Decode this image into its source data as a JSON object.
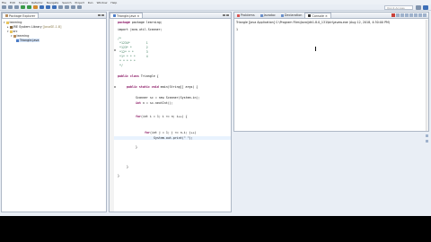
{
  "menubar": {
    "items": [
      "File",
      "Edit",
      "Source",
      "Refactor",
      "Navigate",
      "Search",
      "Project",
      "Run",
      "Window",
      "Help"
    ]
  },
  "toolbar": {
    "quick_access_label": "Quick Access"
  },
  "explorer": {
    "tab_label": "Package Explorer",
    "tree": {
      "project": "learning",
      "jre": "JRE System Library",
      "jre_decor": "[JavaSE-1.8]",
      "src": "src",
      "package": "learning",
      "file": "Triangle.java"
    }
  },
  "editor": {
    "tab_label": "Triangle.java",
    "lines": {
      "l1": "package learning;",
      "l3": "import java.util.Scanner;",
      "l5": "/*",
      "l6": " *1234*         1",
      "l7": " *123* *        2",
      "l8": " *12* * *       3",
      "l9": " *1* * * *      4",
      "l10": " * * * * *",
      "l11": " */",
      "l13a": "public class ",
      "l13b": "Triangle {",
      "l15a": "public static void ",
      "l15b": "main(String[] args) {",
      "l17": "Scanner sc = new Scanner(System.in);",
      "l18a": "int ",
      "l18b": "n = sc.nextInt();",
      "l20a": "for",
      "l20b": "(int i = 1; i <= n; i++) {",
      "l22a": "for",
      "l22b": "(int j = 1; j <= n-i; j++)",
      "l23": "System.out.print(\" \");",
      "l25": "}",
      "l28": "}",
      "l30": "}"
    }
  },
  "console": {
    "tabs": [
      "Problems",
      "Javadoc",
      "Declaration",
      "Console"
    ],
    "header": "Triangle [Java Application] C:\\Program Files\\Java\\jdk1.8.0_131\\bin\\javaw.exe (Aug 12, 2018, 4:30:00 PM)",
    "output": "1"
  },
  "colors": {
    "keyword": "#7f0055",
    "comment": "#3f7f5f",
    "selection": "#cfe0f7"
  }
}
